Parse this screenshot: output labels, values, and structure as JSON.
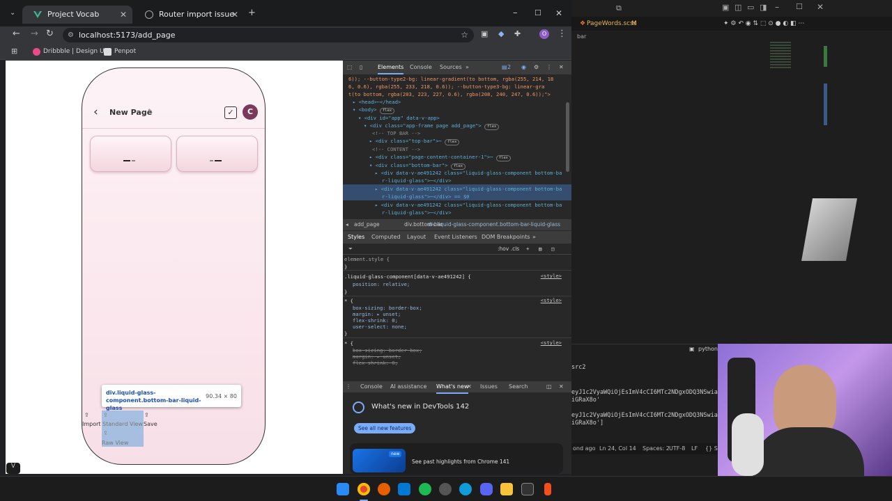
{
  "browser": {
    "tabs": [
      {
        "title": "Project Vocab",
        "active": true
      },
      {
        "title": "Router import issue",
        "active": false
      }
    ],
    "url": "localhost:5173/add_page",
    "bookmarks": [
      "Dribbble | Design U...",
      "Penpot"
    ],
    "profile_initial": "O"
  },
  "app": {
    "title": "New Page",
    "avatar_initial": "C",
    "tooltip": {
      "selector": "div.liquid-glass-component.bottom-bar-liquid-glass",
      "size": "90.34 × 80"
    },
    "bottom_bar": {
      "import": "Import",
      "standard_view": "Standard View",
      "save": "Save",
      "raw_view": "Raw View"
    }
  },
  "devtools": {
    "tabs": [
      "Elements",
      "Console",
      "Sources"
    ],
    "issues_count": "2",
    "dom_lines": [
      "6)); --button-type2-bg: linear-gradient(to bottom, rgba(255, 214, 18",
      "6, 0.6), rgba(255, 233, 218, 0.6)); --button-type3-bg: linear-gra",
      "t(to bottom, rgba(203, 223, 227, 0.6), rgba(208, 240, 247, 0.6));\">"
    ],
    "tree": {
      "head": "<head>",
      "head_close": "</head>",
      "body": "<body>",
      "app": "<div id=\"app\" data-v-app>",
      "frame": "<div class=\"app-frame page add_page\">",
      "cmt_top": "<!-- TOP BAR -->",
      "top_bar": "<div class=\"top-bar\">",
      "cmt_content": "<!-- CONTENT -->",
      "content": "<div class=\"page-content-container-1\">",
      "bottom_bar": "<div class=\"bottom-bar\">",
      "lg1a": "<div data-v-ae491242 class=\"liquid-glass-component bottom-ba",
      "lg1b": "r-liquid-glass\">",
      "lg1c": "</div>",
      "lg2b_tail": "</div> == $0",
      "flex": "flex"
    },
    "breadcrumbs": [
      "add_page",
      "div.bottom-bar",
      "div.liquid-glass-component.bottom-bar-liquid-glass"
    ],
    "style_tabs": [
      "Styles",
      "Computed",
      "Layout",
      "Event Listeners",
      "DOM Breakpoints"
    ],
    "filter_hint": ":hov .cls",
    "rules": {
      "element_style": "element.style {",
      "rule1_selector": ".liquid-glass-component[data-v-ae491242] {",
      "rule1_prop": "position: relative;",
      "star": "* {",
      "box_sizing": "box-sizing: border-box;",
      "margin": "margin: ▸ unset;",
      "flex_shrink": "flex-shrink: 0;",
      "user_select": "user-select: none;",
      "close": "}",
      "source": "<style>"
    },
    "drawer_tabs": [
      "Console",
      "AI assistance",
      "What's new",
      "Issues",
      "Search"
    ],
    "whats_new": "What's new in DevTools 142",
    "see_all": "See all new features",
    "highlights": "See past highlights from Chrome 141",
    "new_badge": "new"
  },
  "editor": {
    "file_tab": "PageWords.scss",
    "file_status": "M",
    "crumb": "bar",
    "panel_label": "python",
    "terminal": [
      "src2",
      "eyJ1c2VyaWQiOjEsImV4cCI6MTc2NDgxODQ3NSwiaW",
      "iGRaX8o'",
      "eyJ1c2VyaWQiOjEsImV4cCI6MTc2NDgxODQ3NSwiaW",
      "iGRaX8o']"
    ],
    "status": {
      "left": "ond ago",
      "pos": "Ln 24, Col 14",
      "spaces": "Spaces: 2",
      "enc": "UTF-8",
      "eol": "LF",
      "lang": "{} S"
    }
  }
}
